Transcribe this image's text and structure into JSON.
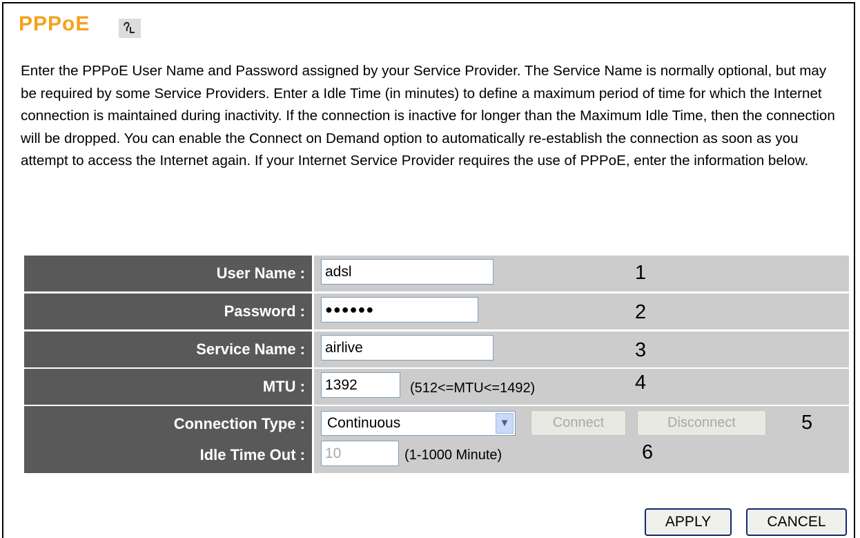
{
  "page": {
    "title": "PPPoE",
    "help_icon": "help-icon",
    "description": "Enter the PPPoE User Name and Password assigned by your Service Provider. The Service Name is normally optional, but may be required by some Service Providers. Enter a Idle Time (in minutes) to define a maximum period of time for which the Internet connection is maintained during inactivity. If the connection is inactive for longer than the Maximum Idle Time, then the connection will be dropped. You can enable the Connect on Demand option to automatically re-establish the connection as soon as you attempt to access the Internet again. If your Internet Service Provider requires the use of PPPoE, enter the information below."
  },
  "form": {
    "user_name": {
      "label": "User Name :",
      "value": "adsl",
      "marker": "1"
    },
    "password": {
      "label": "Password :",
      "value": "●●●●●●",
      "marker": "2"
    },
    "service_name": {
      "label": "Service Name :",
      "value": "airlive",
      "marker": "3"
    },
    "mtu": {
      "label": "MTU :",
      "value": "1392",
      "hint": "(512<=MTU<=1492)",
      "marker": "4"
    },
    "connection_type": {
      "label": "Connection Type :",
      "selected": "Continuous",
      "connect_label": "Connect",
      "disconnect_label": "Disconnect",
      "marker": "5"
    },
    "idle_time_out": {
      "label": "Idle Time Out :",
      "value": "10",
      "hint": "(1-1000 Minute)",
      "marker": "6"
    }
  },
  "actions": {
    "apply_label": "APPLY",
    "cancel_label": "CANCEL"
  },
  "colors": {
    "title": "#f4a21b",
    "label_bg": "#595959",
    "value_bg": "#cccccc"
  }
}
